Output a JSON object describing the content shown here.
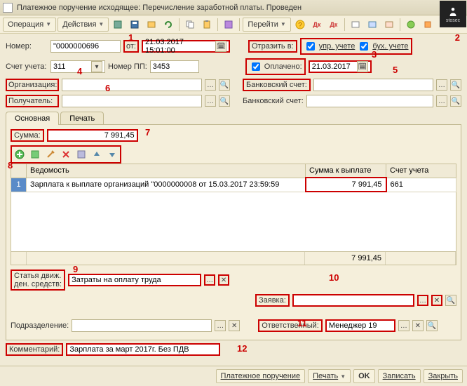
{
  "window": {
    "title": "Платежное поручение исходящее: Перечисление заработной платы. Проведен"
  },
  "toolbar": {
    "operation": "Операция",
    "actions": "Действия",
    "goto": "Перейти"
  },
  "labels": {
    "number": "Номер:",
    "ot": "от:",
    "account": "Счет учета:",
    "pp": "Номер ПП:",
    "org": "Организация:",
    "recv": "Получатель:",
    "reflect": "Отразить в:",
    "upr": "упр. учете",
    "bukh": "бух. учете",
    "paid": "Оплачено:",
    "bank1": "Банковский счет:",
    "bank2": "Банковский счет:",
    "sum": "Сумма:",
    "stat": "Статья движ.",
    "stat2": "ден. средств:",
    "zayavka": "Заявка:",
    "podr": "Подразделение:",
    "resp": "Ответственный:",
    "comment": "Комментарий:"
  },
  "values": {
    "number": "\"0000000696",
    "date": "21.03.2017 15:01:00",
    "account": "311",
    "pp": "3453",
    "paid_date": "21.03.2017",
    "sum": "7 991,45",
    "stat": "Затраты на оплату труда",
    "resp": "Менеджер 19",
    "comment": "Зарплата за март  2017г. Без ПДВ"
  },
  "tabs": {
    "main": "Основная",
    "print": "Печать"
  },
  "grid": {
    "headers": {
      "c1": "Ведомость",
      "c2": "Сумма к выплате",
      "c3": "Счет учета"
    },
    "row": {
      "n": "1",
      "vedomost": "Зарплата к выплате организаций \"0000000008 от 15.03.2017 23:59:59",
      "sum": "7 991,45",
      "account": "661"
    },
    "footer_sum": "7 991,45"
  },
  "bottom": {
    "pp": "Платежное поручение",
    "print": "Печать",
    "ok": "OK",
    "save": "Записать",
    "close": "Закрыть"
  },
  "nums": {
    "n1": "1",
    "n2": "2",
    "n3": "3",
    "n4": "4",
    "n5": "5",
    "n6": "6",
    "n7": "7",
    "n8": "8",
    "n9": "9",
    "n10": "10",
    "n11": "11",
    "n12": "12"
  },
  "logo": "stosec"
}
